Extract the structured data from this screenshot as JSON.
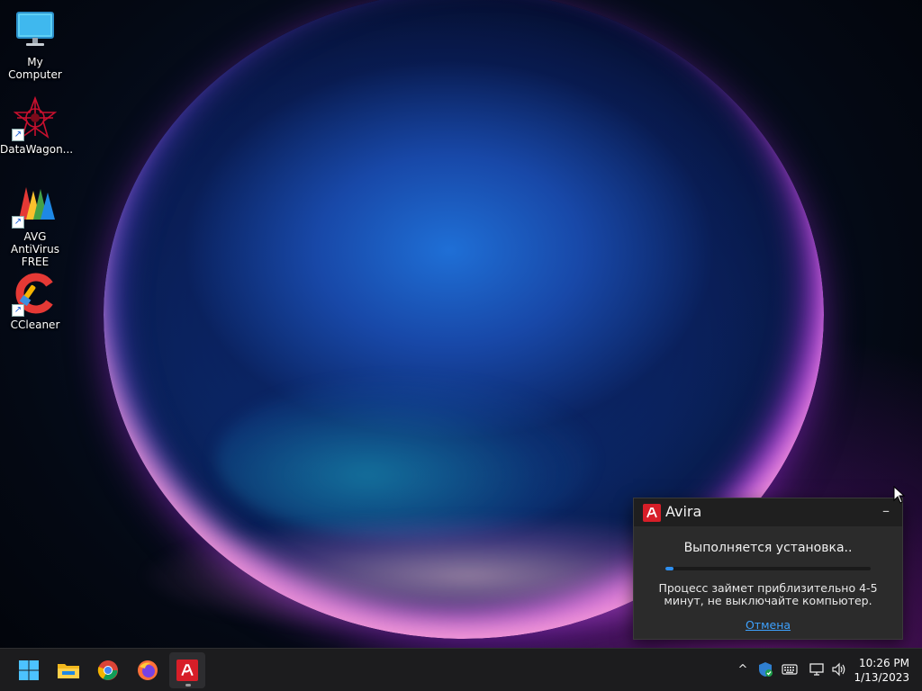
{
  "desktop": {
    "icons": [
      {
        "label": "My Computer"
      },
      {
        "label": "DataWagon..."
      },
      {
        "label": "AVG AntiVirus FREE"
      },
      {
        "label": "CCleaner"
      }
    ]
  },
  "avira": {
    "title": "Avira",
    "minimize_glyph": "–",
    "status": "Выполняется установка..",
    "message": "Процесс займет приблизительно 4-5 минут, не выключайте компьютер.",
    "cancel_label": "Отмена",
    "progress": 0.04,
    "accent": "#d71e28",
    "bar_color": "#2e8ff0"
  },
  "taskbar": {
    "apps": [
      "start-icon",
      "file-explorer-icon",
      "chrome-icon",
      "firefox-icon",
      "avira-icon"
    ],
    "tray": {
      "chevron_glyph": "^"
    },
    "clock": {
      "time": "10:26 PM",
      "date": "1/13/2023"
    }
  }
}
